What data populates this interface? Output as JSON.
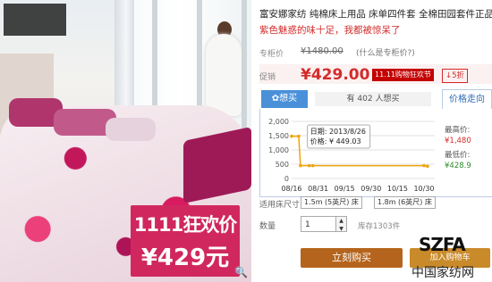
{
  "image": {
    "promo_line1": "1111狂欢价",
    "promo_line2": "¥429元",
    "zoom_icon": "magnifier-icon"
  },
  "product": {
    "title": "富安娜家纺 纯棉床上用品 床单四件套 全棉田园套件正品",
    "subtitle": "紫色魅惑的味十足，我都被惊呆了"
  },
  "pricing": {
    "ref_label": "专柜价",
    "ref_price": "¥1480.00",
    "what_link": "(什么是专柜价?)",
    "promo_label": "促销",
    "price": "¥429.00",
    "badge": "11.11购物狂欢节",
    "discount": "↓5折"
  },
  "tabs": {
    "want": "✿想买",
    "want_count": "有 402 人想买",
    "trend": "价格走向"
  },
  "chart_data": {
    "type": "line",
    "x_ticks": [
      "08/16",
      "08/31",
      "09/15",
      "09/30",
      "10/15",
      "10/30"
    ],
    "y_ticks": [
      "2,000",
      "1,500",
      "1,000",
      "500",
      "0"
    ],
    "ylim": [
      0,
      2000
    ],
    "series": [
      {
        "x": [
          "08/16",
          "08/20",
          "08/21",
          "08/26",
          "08/28",
          "10/30",
          "11/01"
        ],
        "values": [
          1480,
          1480,
          449.03,
          449.03,
          449.03,
          449.03,
          428.9
        ]
      }
    ],
    "tooltip": {
      "date_label": "日期:",
      "date": "2013/8/26",
      "price_label": "价格:",
      "price": "¥ 449.03"
    },
    "max_label": "最高价:",
    "max": "¥1,480",
    "min_label": "最低价:",
    "min": "¥428.9",
    "line_color": "#f0a30a"
  },
  "options": {
    "size_label": "适用床尺寸",
    "sizes": [
      "1.5m (5英尺) 床",
      "1.8m (6英尺) 床"
    ],
    "qty_label": "数量",
    "qty": "1",
    "stock": "库存1303件"
  },
  "actions": {
    "buy": "立刻购买",
    "cart": "加入购物车"
  },
  "watermark": {
    "brand": "SZFA",
    "site": "中国家纺网"
  }
}
